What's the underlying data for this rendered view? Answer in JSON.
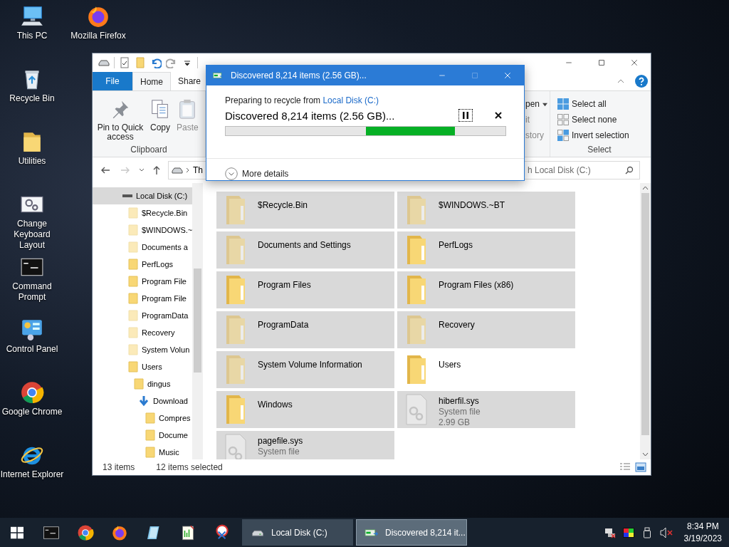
{
  "desktop_icons": [
    {
      "label": "This PC",
      "kind": "pc"
    },
    {
      "label": "Recycle Bin",
      "kind": "recycle"
    },
    {
      "label": "Utilities",
      "kind": "folder"
    },
    {
      "label": "Change Keyboard Layout",
      "kind": "keyboard"
    },
    {
      "label": "Command Prompt",
      "kind": "cmd"
    },
    {
      "label": "Control Panel",
      "kind": "control"
    },
    {
      "label": "Google Chrome",
      "kind": "chrome"
    },
    {
      "label": "Internet Explorer",
      "kind": "ie"
    },
    {
      "label": "Mozilla Firefox",
      "kind": "firefox"
    }
  ],
  "explorer": {
    "quick_access": [
      {
        "kind": "drive",
        "disabled": false
      },
      {
        "kind": "properties",
        "disabled": false
      },
      {
        "kind": "new-folder",
        "disabled": false
      },
      {
        "kind": "undo",
        "disabled": false
      },
      {
        "kind": "redo",
        "disabled": true
      },
      {
        "kind": "customize",
        "disabled": false
      }
    ],
    "tabs": [
      {
        "label": "File",
        "kind": "file",
        "selected": false
      },
      {
        "label": "Home",
        "kind": "tab",
        "selected": true
      },
      {
        "label": "Share",
        "kind": "tab",
        "selected": false
      }
    ],
    "clipboard": {
      "buttons": [
        {
          "label": "Pin to Quick access",
          "kind": "pin",
          "disabled": false
        },
        {
          "label": "Copy",
          "kind": "copy",
          "disabled": false
        },
        {
          "label": "Paste",
          "kind": "paste",
          "disabled": true
        }
      ],
      "group_label": "Clipboard"
    },
    "open_partial": [
      {
        "label": "pen",
        "disabled": false,
        "dropdown": true
      },
      {
        "label": "it",
        "disabled": true,
        "dropdown": false
      },
      {
        "label": "story",
        "disabled": true,
        "dropdown": false
      }
    ],
    "select": {
      "buttons": [
        {
          "label": "Select all",
          "kind": "all"
        },
        {
          "label": "Select none",
          "kind": "none"
        },
        {
          "label": "Invert selection",
          "kind": "invert"
        }
      ],
      "group_label": "Select"
    },
    "address": {
      "path": "Th"
    },
    "search": {
      "placeholder": "h Local Disk (C:)"
    },
    "nav_tree": [
      {
        "label": "Local Disk (C:)",
        "kind": "drive",
        "selected": true,
        "hidden": false,
        "children": [
          {
            "label": "$Recycle.Bin",
            "kind": "folder",
            "selected": false,
            "hidden": true
          },
          {
            "label": "$WINDOWS.~",
            "kind": "folder",
            "selected": false,
            "hidden": true
          },
          {
            "label": "Documents a",
            "kind": "folder",
            "selected": false,
            "hidden": true
          },
          {
            "label": "PerfLogs",
            "kind": "folder",
            "selected": false,
            "hidden": false
          },
          {
            "label": "Program File",
            "kind": "folder",
            "selected": false,
            "hidden": false
          },
          {
            "label": "Program File",
            "kind": "folder",
            "selected": false,
            "hidden": false
          },
          {
            "label": "ProgramData",
            "kind": "folder",
            "selected": false,
            "hidden": true
          },
          {
            "label": "Recovery",
            "kind": "folder",
            "selected": false,
            "hidden": true
          },
          {
            "label": "System Volun",
            "kind": "folder",
            "selected": false,
            "hidden": true
          },
          {
            "label": "Users",
            "kind": "folder",
            "selected": false,
            "hidden": false,
            "children": [
              {
                "label": "dingus",
                "kind": "folder",
                "selected": false,
                "hidden": false,
                "children": [
                  {
                    "label": "Download",
                    "kind": "downloads",
                    "selected": false,
                    "hidden": false,
                    "children": [
                      {
                        "label": "Compres",
                        "kind": "folder",
                        "selected": false,
                        "hidden": false
                      },
                      {
                        "label": "Docume",
                        "kind": "folder",
                        "selected": false,
                        "hidden": false
                      },
                      {
                        "label": "Music",
                        "kind": "folder",
                        "selected": false,
                        "hidden": false
                      }
                    ]
                  }
                ]
              }
            ]
          }
        ]
      }
    ],
    "items": [
      {
        "name": "$Recycle.Bin",
        "kind": "folder",
        "selected": true,
        "hidden": true
      },
      {
        "name": "$WINDOWS.~BT",
        "kind": "folder",
        "selected": true,
        "hidden": true
      },
      {
        "name": "Documents and Settings",
        "kind": "folder",
        "selected": true,
        "hidden": true
      },
      {
        "name": "PerfLogs",
        "kind": "folder",
        "selected": true,
        "hidden": false
      },
      {
        "name": "Program Files",
        "kind": "folder",
        "selected": true,
        "hidden": false
      },
      {
        "name": "Program Files (x86)",
        "kind": "folder",
        "selected": true,
        "hidden": false
      },
      {
        "name": "ProgramData",
        "kind": "folder",
        "selected": true,
        "hidden": true
      },
      {
        "name": "Recovery",
        "kind": "folder",
        "selected": true,
        "hidden": true
      },
      {
        "name": "System Volume Information",
        "kind": "folder",
        "selected": true,
        "hidden": true
      },
      {
        "name": "Users",
        "kind": "folder",
        "selected": false,
        "hidden": false
      },
      {
        "name": "Windows",
        "kind": "folder",
        "selected": true,
        "hidden": false
      },
      {
        "name": "hiberfil.sys",
        "kind": "file",
        "type": "System file",
        "size": "2.99 GB",
        "selected": true,
        "hidden": true
      },
      {
        "name": "pagefile.sys",
        "kind": "file",
        "type": "System file",
        "selected": true,
        "hidden": true
      }
    ],
    "status": {
      "count": "13 items",
      "selection": "12 items selected"
    }
  },
  "dialog": {
    "title": "Discovered 8,214 items (2.56 GB)...",
    "window_buttons": [
      {
        "kind": "minimize",
        "disabled": false
      },
      {
        "kind": "maximize",
        "disabled": true
      },
      {
        "kind": "close",
        "disabled": false
      }
    ],
    "intro": "Preparing to recycle from ",
    "source_link": "Local Disk (C:)",
    "heading": "Discovered 8,214 items (2.56 GB)...",
    "actions": [
      {
        "kind": "pause",
        "focused": true
      },
      {
        "kind": "cancel",
        "focused": false
      }
    ],
    "more_details": "More details"
  },
  "taskbar": {
    "pinned": [
      {
        "kind": "start"
      },
      {
        "kind": "cmd"
      },
      {
        "kind": "chrome"
      },
      {
        "kind": "firefox"
      },
      {
        "kind": "glass"
      },
      {
        "kind": "notepad"
      },
      {
        "kind": "snip"
      }
    ],
    "tasks": [
      {
        "label": "Local Disk (C:)",
        "kind": "drive",
        "selected": false
      },
      {
        "label": "Discovered 8,214 it...",
        "kind": "progress",
        "selected": true
      }
    ],
    "tray": [
      {
        "kind": "network"
      },
      {
        "kind": "color"
      },
      {
        "kind": "usb"
      },
      {
        "kind": "volume",
        "muted": true
      }
    ],
    "time": "8:34 PM",
    "date": "3/19/2023"
  }
}
